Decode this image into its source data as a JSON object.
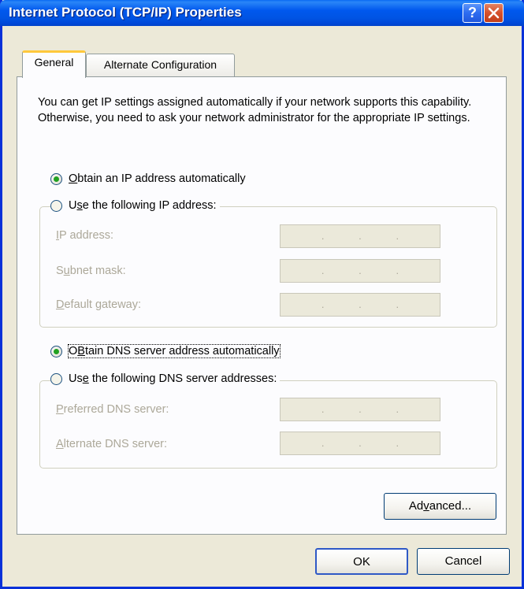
{
  "window": {
    "title": "Internet Protocol (TCP/IP) Properties",
    "help_glyph": "?",
    "close_glyph": "✕"
  },
  "tabs": [
    {
      "label": "General"
    },
    {
      "label": "Alternate Configuration"
    }
  ],
  "description": "You can get IP settings assigned automatically if your network supports this capability. Otherwise, you need to ask your network administrator for the appropriate IP settings.",
  "ip": {
    "auto_option": {
      "pre": "",
      "u": "O",
      "post": "btain an IP address automatically",
      "selected": true
    },
    "manual_option": {
      "pre": "U",
      "u": "s",
      "post": "e the following IP address:",
      "selected": false
    },
    "fields": [
      {
        "pre": "",
        "u": "I",
        "post": "P address:",
        "value": ""
      },
      {
        "pre": "S",
        "u": "u",
        "post": "bnet mask:",
        "value": ""
      },
      {
        "pre": "",
        "u": "D",
        "post": "efault gateway:",
        "value": ""
      }
    ]
  },
  "dns": {
    "auto_option": {
      "pre": "",
      "u": "B",
      "post": "tain DNS server address automatically",
      "selected": true
    },
    "manual_option": {
      "pre": "Us",
      "u": "e",
      "post": " the following DNS server addresses:",
      "selected": false
    },
    "fields": [
      {
        "pre": "",
        "u": "P",
        "post": "referred DNS server:",
        "value": ""
      },
      {
        "pre": "",
        "u": "A",
        "post": "lternate DNS server:",
        "value": ""
      }
    ]
  },
  "buttons": {
    "advanced": {
      "pre": "Ad",
      "u": "v",
      "post": "anced..."
    },
    "ok": "OK",
    "cancel": "Cancel"
  },
  "colors": {
    "titlebar": "#0054E3",
    "dialog_bg": "#ECE9D8",
    "panel_bg": "#FCFCFE",
    "radio_selected": "#21A121",
    "disabled_text": "#ACA899"
  }
}
